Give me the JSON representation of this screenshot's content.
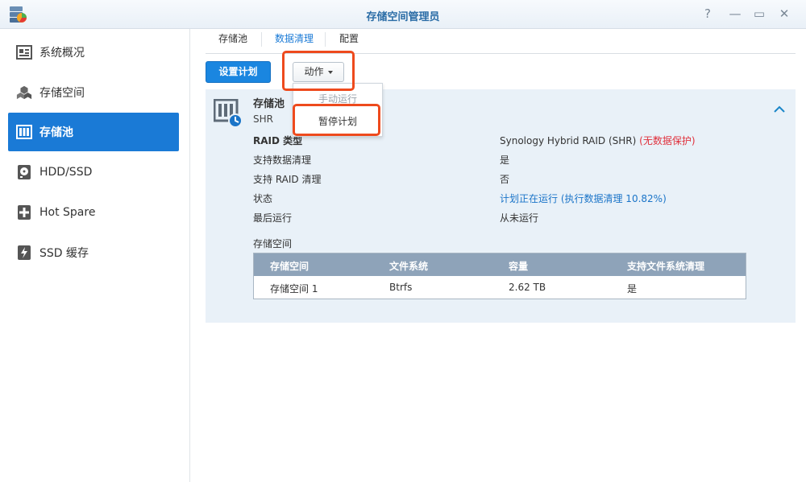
{
  "window": {
    "title": "存储空间管理员",
    "controls": [
      "?",
      "—",
      "▭",
      "✕"
    ]
  },
  "sidebar": {
    "items": [
      {
        "label": "系统概况",
        "icon": "overview-card-icon",
        "active": false
      },
      {
        "label": "存储空间",
        "icon": "cubes-icon",
        "active": false
      },
      {
        "label": "存储池",
        "icon": "storage-pool-icon",
        "active": true
      },
      {
        "label": "HDD/SSD",
        "icon": "hard-disk-icon",
        "active": false
      },
      {
        "label": "Hot Spare",
        "icon": "plus-box-icon",
        "active": false
      },
      {
        "label": "SSD 缓存",
        "icon": "lightning-box-icon",
        "active": false
      }
    ]
  },
  "tabs": [
    {
      "label": "存储池",
      "active": false
    },
    {
      "label": "数据清理",
      "active": true
    },
    {
      "label": "配置",
      "active": false
    }
  ],
  "toolbar": {
    "schedule_label": "设置计划",
    "action_label": "动作"
  },
  "dropdown": {
    "items": [
      "手动运行",
      "暂停计划"
    ]
  },
  "pool": {
    "name": "存储池",
    "type": "SHR",
    "properties": [
      {
        "label": "RAID 类型",
        "value": "Synology Hybrid RAID (SHR)",
        "note": "(无数据保护)"
      },
      {
        "label": "支持数据清理",
        "value": "是",
        "note": ""
      },
      {
        "label": "支持 RAID 清理",
        "value": "否",
        "note": ""
      },
      {
        "label": "状态",
        "value": "计划正在运行 (执行数据清理 10.82%)",
        "note": ""
      },
      {
        "label": "最后运行",
        "value": "从未运行",
        "note": ""
      }
    ]
  },
  "volume_table": {
    "section_label": "存储空间",
    "headers": [
      "存储空间",
      "文件系统",
      "容量",
      "支持文件系统清理"
    ],
    "rows": [
      [
        "存储空间 1",
        "Btrfs",
        "2.62 TB",
        "是"
      ]
    ]
  },
  "colors": {
    "accent": "#1a7ad6",
    "highlight": "#ee4a1d",
    "warning_red": "#e0303c",
    "panel_bg": "#e9f1f8",
    "table_header": "#8ea3b9"
  }
}
